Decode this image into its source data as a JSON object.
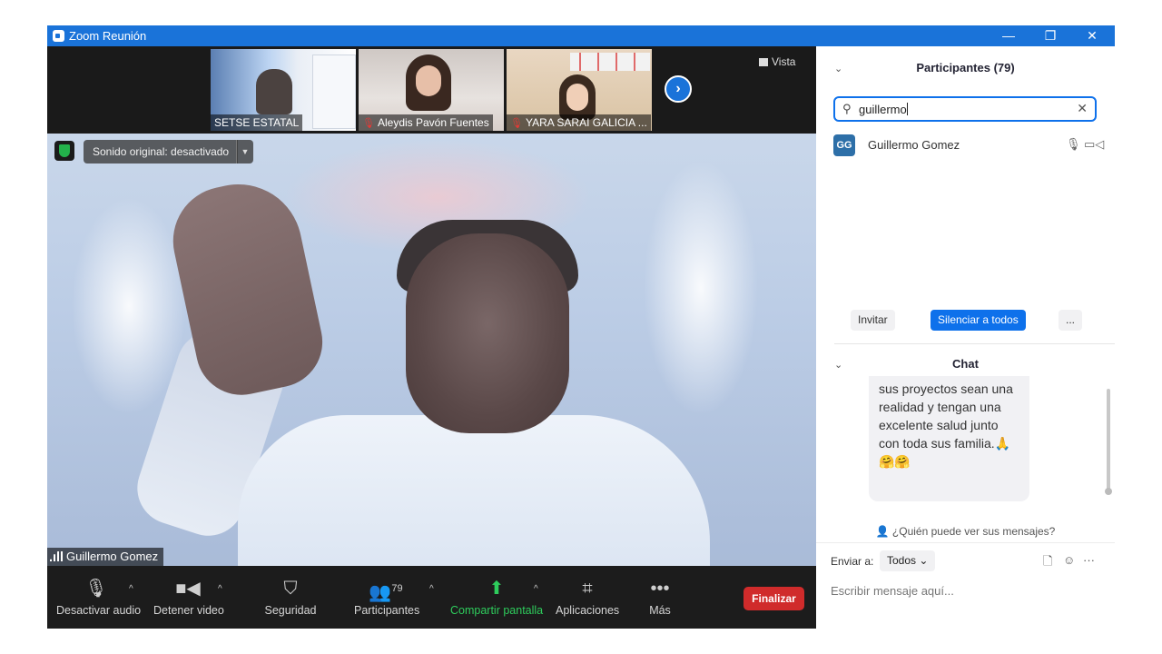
{
  "window": {
    "title": "Zoom Reunión",
    "min": "—",
    "restore": "❐",
    "close": "✕"
  },
  "strip": {
    "thumbnails": [
      {
        "name": "SETSE ESTATAL",
        "muted": false
      },
      {
        "name": "Aleydis Pavón Fuentes",
        "muted": true
      },
      {
        "name": "YARA SARAI GALICIA ...",
        "muted": true
      }
    ],
    "next_icon": "chevron-right-icon",
    "view_label": "Vista"
  },
  "video": {
    "original_sound_label": "Sonido original: desactivado",
    "speaker_name": "Guillermo Gomez"
  },
  "toolbar": {
    "audio": "Desactivar audio",
    "video": "Detener video",
    "security": "Seguridad",
    "participants": "Participantes",
    "participants_count": "79",
    "share": "Compartir pantalla",
    "apps": "Aplicaciones",
    "more": "Más",
    "end": "Finalizar"
  },
  "participants_panel": {
    "title": "Participantes (79)",
    "search_value": "guillermo",
    "results": [
      {
        "initials": "GG",
        "name": "Guillermo Gomez"
      }
    ],
    "invite": "Invitar",
    "mute_all": "Silenciar a todos",
    "more": "..."
  },
  "chat_panel": {
    "title": "Chat",
    "message_lines": [
      "sus proyectos sean una",
      "realidad y tengan una",
      "excelente salud junto",
      "con toda sus familia."
    ],
    "emoji_line": "🤗🤗",
    "who_can_see": "¿Quién puede ver sus mensajes?",
    "send_to_label": "Enviar a:",
    "send_to_value": "Todos",
    "input_placeholder": "Escribir mensaje aquí..."
  },
  "colors": {
    "accent": "#0e71eb",
    "titlebar": "#1a73d9",
    "end_button": "#d02b2b",
    "share_green": "#2ecc5c"
  }
}
